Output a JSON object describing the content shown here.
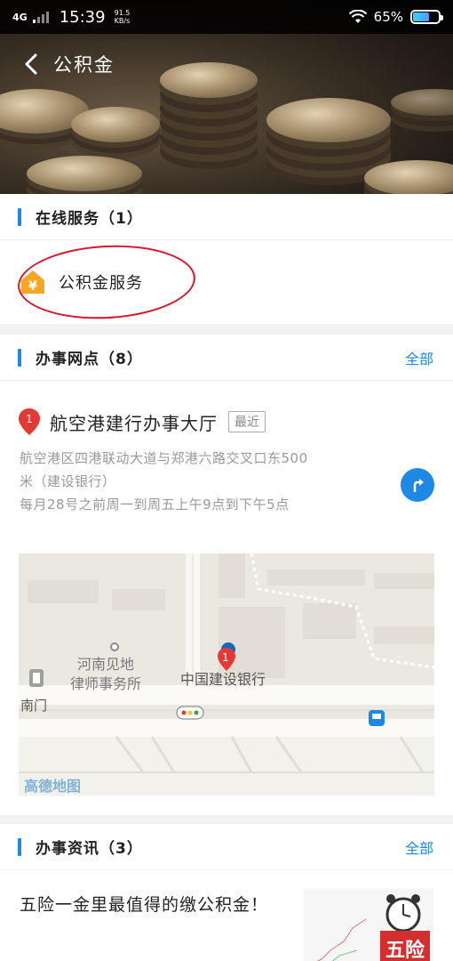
{
  "status_bar": {
    "network": "4G",
    "time": "15:39",
    "speed_value": "91.5",
    "speed_unit": "KB/s",
    "battery": "65%"
  },
  "header": {
    "title": "公积金"
  },
  "online_service": {
    "title": "在线服务（1）",
    "items": [
      {
        "label": "公积金服务",
        "icon": "yuan-house-icon"
      }
    ]
  },
  "offices": {
    "title": "办事网点（8）",
    "all_label": "全部",
    "items": [
      {
        "marker": "1",
        "name": "航空港建行办事大厅",
        "tag": "最近",
        "address": "航空港区四港联动大道与郑港六路交叉口东500米（建设银行）",
        "hours": "每月28号之前周一到周五上午9点到下午5点"
      }
    ]
  },
  "map": {
    "label_poi_1": "河南见地",
    "label_poi_2": "律师事务所",
    "label_bank": "中国建设银行",
    "label_gate": "南门",
    "marker": "1",
    "brand": "高德地图"
  },
  "news": {
    "title": "办事资讯（3）",
    "all_label": "全部",
    "items": [
      {
        "title": "五险一金里最值得的缴公积金！",
        "thumb_text": "五险"
      }
    ]
  },
  "colors": {
    "accent": "#1e88e5",
    "marker_red": "#e53935",
    "annotation": "#d9142b"
  }
}
